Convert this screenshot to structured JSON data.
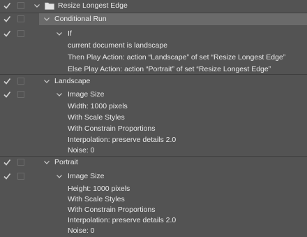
{
  "action_set": {
    "title": "Resize Longest Edge"
  },
  "conditional": {
    "title": "Conditional Run",
    "if_label": "If",
    "condition": "current document is landscape",
    "then": "Then Play Action: action “Landscape” of set “Resize Longest Edge”",
    "else": "Else Play Action: action “Portrait” of set “Resize Longest Edge”"
  },
  "landscape": {
    "title": "Landscape",
    "step": "Image Size",
    "details": [
      "Width: 1000 pixels",
      "With Scale Styles",
      "With Constrain Proportions",
      "Interpolation: preserve details 2.0",
      "Noise: 0"
    ]
  },
  "portrait": {
    "title": "Portrait",
    "step": "Image Size",
    "details": [
      "Height: 1000 pixels",
      "With Scale Styles",
      "With Constrain Proportions",
      "Interpolation: preserve details 2.0",
      "Noise: 0"
    ]
  },
  "colors": {
    "panel_bg": "#535353",
    "selected_row": "#6a6a6a",
    "text": "#e8e8e8",
    "check": "#d0d0d0"
  }
}
